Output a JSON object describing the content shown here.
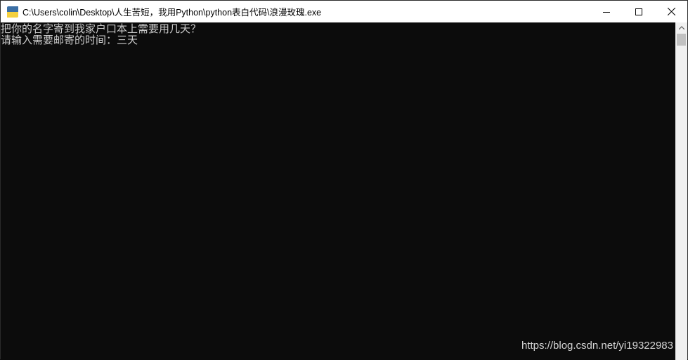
{
  "window": {
    "title": "C:\\Users\\colin\\Desktop\\人生苦短，我用Python\\python表白代码\\浪漫玫瑰.exe",
    "icon": "python-icon",
    "controls": {
      "minimize_icon": "minimize-icon",
      "maximize_icon": "maximize-icon",
      "close_icon": "close-icon"
    }
  },
  "console": {
    "lines": [
      "把你的名字寄到我家户口本上需要用几天？",
      "请输入需要邮寄的时间：三天"
    ],
    "background": "#0c0c0c",
    "foreground": "#cccccc"
  },
  "watermark": "https://blog.csdn.net/yi19322983"
}
